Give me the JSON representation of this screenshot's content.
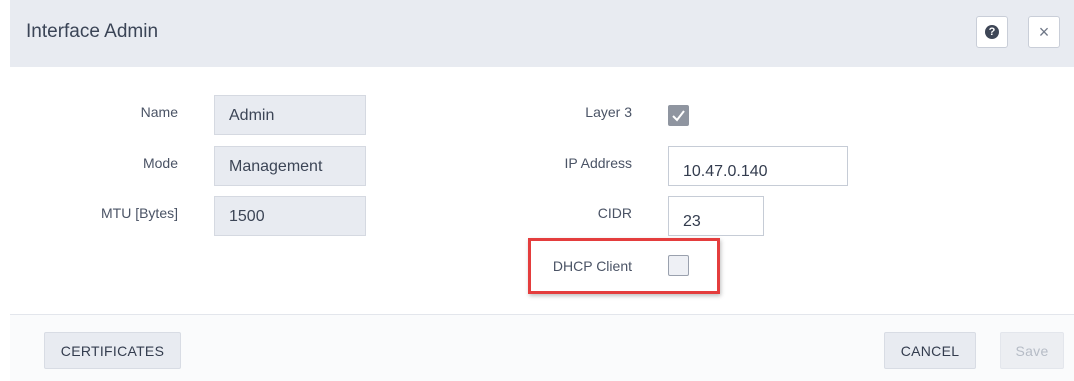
{
  "dialog": {
    "title": "Interface Admin",
    "help_icon_glyph": "?",
    "close_icon_glyph": "×"
  },
  "left_fields": {
    "name": {
      "label": "Name",
      "value": "Admin"
    },
    "mode": {
      "label": "Mode",
      "value": "Management"
    },
    "mtu": {
      "label": "MTU [Bytes]",
      "value": "1500"
    }
  },
  "right_fields": {
    "layer3": {
      "label": "Layer 3",
      "checked": true
    },
    "ip_address": {
      "label": "IP Address",
      "value": "10.47.0.140"
    },
    "cidr": {
      "label": "CIDR",
      "value": "23"
    },
    "dhcp_client": {
      "label": "DHCP Client",
      "checked": false
    }
  },
  "footer": {
    "certificates_label": "CERTIFICATES",
    "cancel_label": "CANCEL",
    "save_label": "Save"
  },
  "colors": {
    "header_bg": "#e8ebf1",
    "highlight_border": "#e43d3d",
    "readonly_bg": "#e8ebf1"
  }
}
